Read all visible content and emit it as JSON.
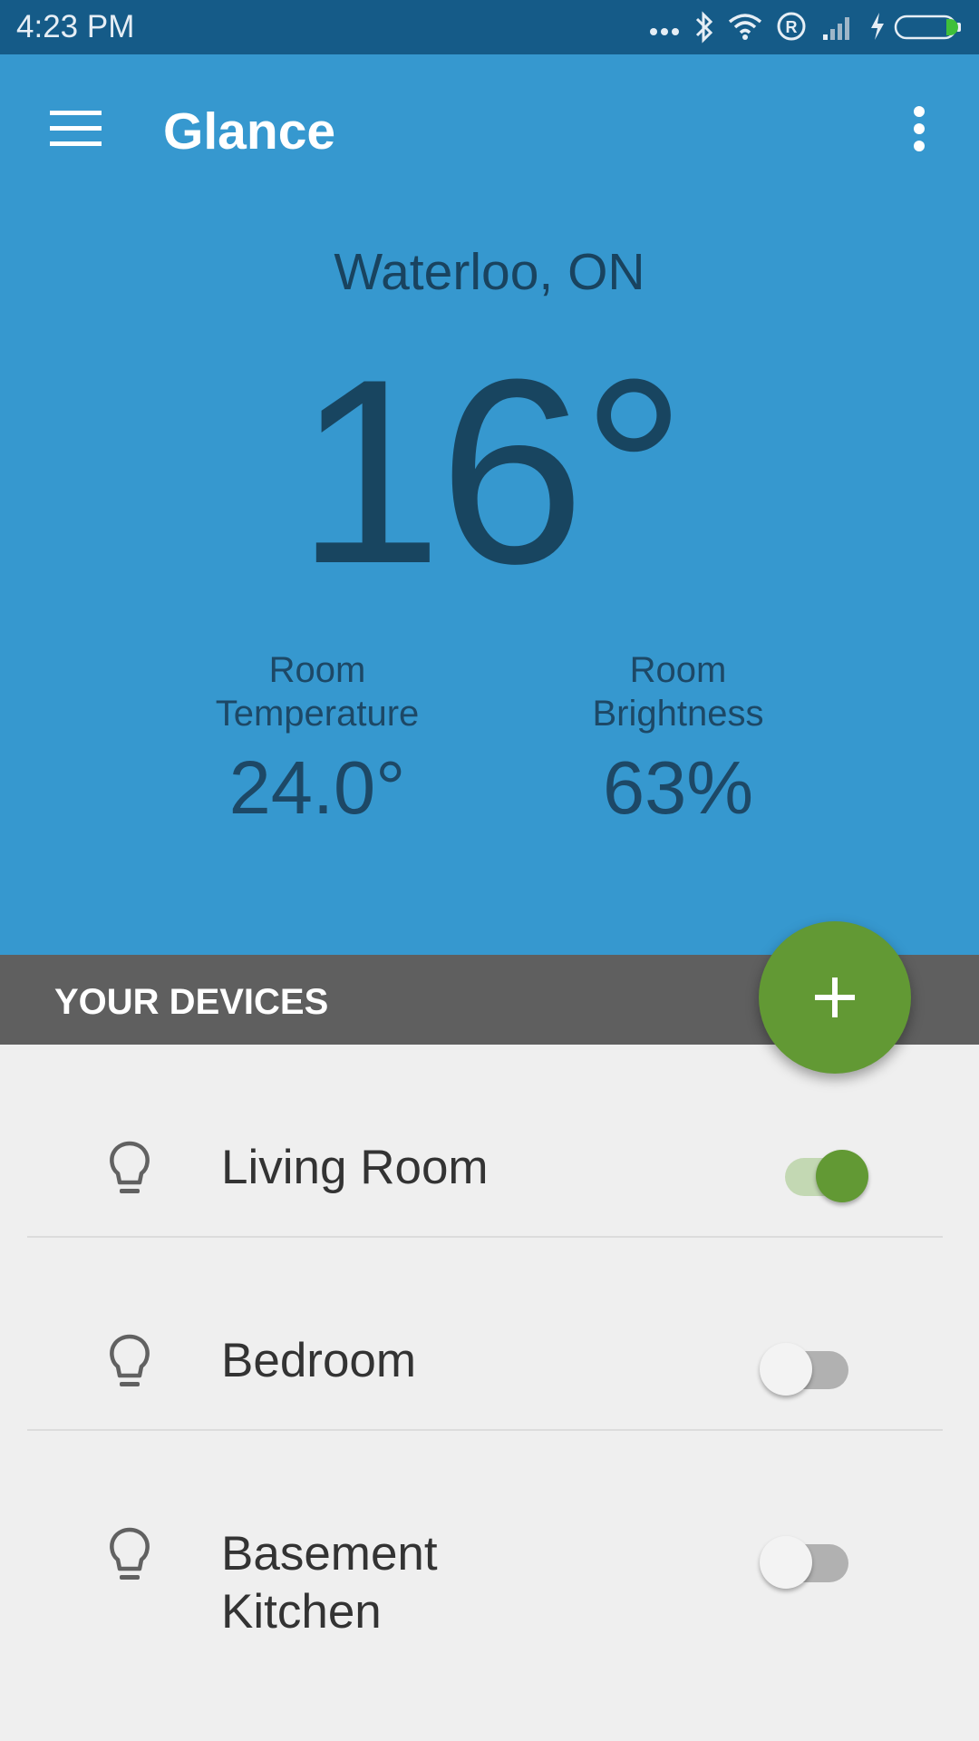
{
  "status_bar": {
    "time": "4:23 PM"
  },
  "header": {
    "title": "Glance"
  },
  "weather": {
    "location": "Waterloo, ON",
    "temperature": "16°"
  },
  "stats": {
    "room_temperature": {
      "label_line1": "Room",
      "label_line2": "Temperature",
      "value": "24.0°"
    },
    "room_brightness": {
      "label_line1": "Room",
      "label_line2": "Brightness",
      "value": "63%"
    }
  },
  "devices_section": {
    "title": "YOUR DEVICES"
  },
  "devices": [
    {
      "name_line1": "Living Room",
      "name_line2": "",
      "on": true,
      "icon": "lightbulb-icon"
    },
    {
      "name_line1": "Bedroom",
      "name_line2": "",
      "on": false,
      "icon": "lightbulb-icon"
    },
    {
      "name_line1": "Basement",
      "name_line2": "Kitchen",
      "on": false,
      "icon": "lightbulb-icon"
    }
  ],
  "colors": {
    "status_bar": "#155b88",
    "header_bg": "#3698cf",
    "section_header_bg": "#5f5f5f",
    "fab_green": "#629934",
    "list_bg": "#efefef"
  }
}
